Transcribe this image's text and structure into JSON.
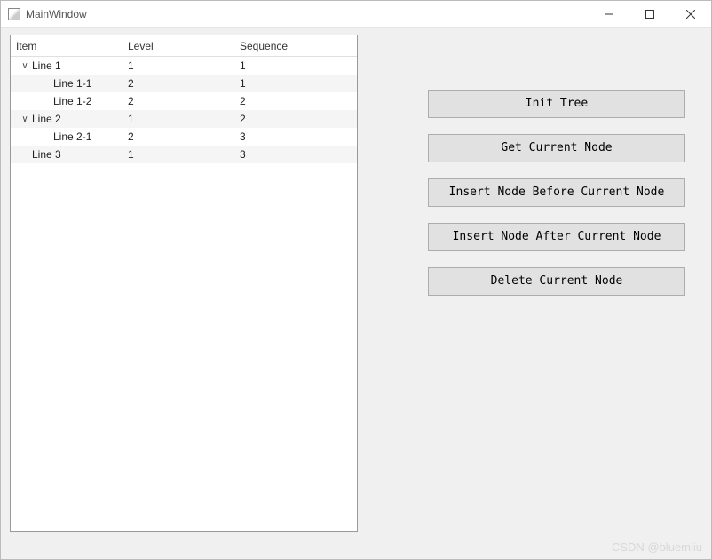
{
  "window": {
    "title": "MainWindow"
  },
  "tree": {
    "headers": {
      "item": "Item",
      "level": "Level",
      "sequence": "Sequence"
    },
    "rows": [
      {
        "item": "Line 1",
        "level": "1",
        "sequence": "1",
        "indent": 0,
        "expander": "∨",
        "alt": false
      },
      {
        "item": "Line 1-1",
        "level": "2",
        "sequence": "1",
        "indent": 1,
        "expander": "",
        "alt": true
      },
      {
        "item": "Line 1-2",
        "level": "2",
        "sequence": "2",
        "indent": 1,
        "expander": "",
        "alt": false
      },
      {
        "item": "Line 2",
        "level": "1",
        "sequence": "2",
        "indent": 0,
        "expander": "∨",
        "alt": true
      },
      {
        "item": "Line 2-1",
        "level": "2",
        "sequence": "3",
        "indent": 1,
        "expander": "",
        "alt": false
      },
      {
        "item": "Line 3",
        "level": "1",
        "sequence": "3",
        "indent": 0,
        "expander": "",
        "alt": true
      }
    ]
  },
  "buttons": {
    "init": "Init Tree",
    "get_current": "Get Current Node",
    "insert_before": "Insert Node Before Current Node",
    "insert_after": "Insert Node After Current Node",
    "delete": "Delete Current Node"
  },
  "watermark": "CSDN @bluemliu"
}
